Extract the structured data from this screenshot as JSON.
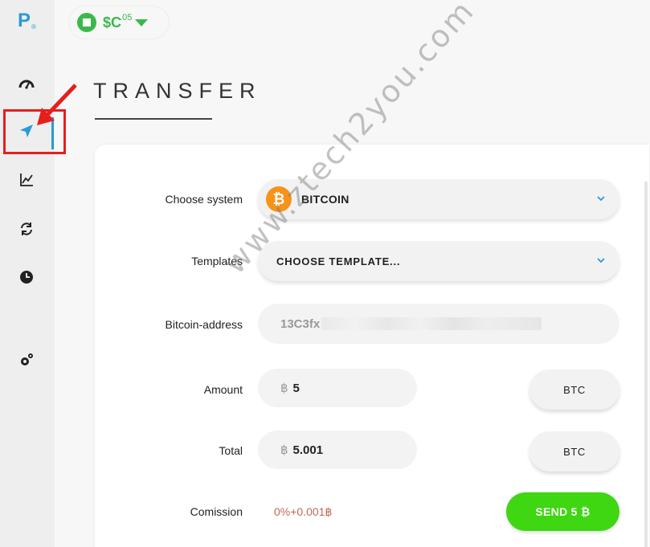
{
  "app": {
    "logo_text": "P",
    "logo_mark": "®"
  },
  "sidebar": {
    "items": [
      {
        "icon": "dashboard-gauge-icon"
      },
      {
        "icon": "send-transfer-icon",
        "active": true
      },
      {
        "icon": "stats-chart-icon"
      },
      {
        "icon": "exchange-cycle-icon"
      },
      {
        "icon": "history-clock-icon"
      },
      {
        "icon": "settings-gear-icon"
      }
    ]
  },
  "balance": {
    "text": "$C",
    "decimals": ".05",
    "color": "#3cb84a"
  },
  "page": {
    "title": "TRANSFER"
  },
  "form": {
    "system": {
      "label": "Choose system",
      "value": "BITCOIN",
      "badge": "₿"
    },
    "templates": {
      "label": "Templates",
      "value": "CHOOSE TEMPLATE..."
    },
    "address": {
      "label": "Bitcoin-address",
      "value": "13C3fx"
    },
    "amount": {
      "label": "Amount",
      "symbol": "฿",
      "value": "5",
      "unit": "BTC"
    },
    "total": {
      "label": "Total",
      "symbol": "฿",
      "value": "5.001",
      "unit": "BTC"
    },
    "commission": {
      "label": "Comission",
      "value": "0%+0.001฿"
    },
    "send_label": "SEND 5 ₿"
  },
  "watermark": "www.ztech2you.com",
  "colors": {
    "accent": "#2a9ad6",
    "send": "#3fd612",
    "commission": "#c06a56",
    "bitcoin": "#f7931a",
    "annotation_red": "#e61e1e"
  }
}
